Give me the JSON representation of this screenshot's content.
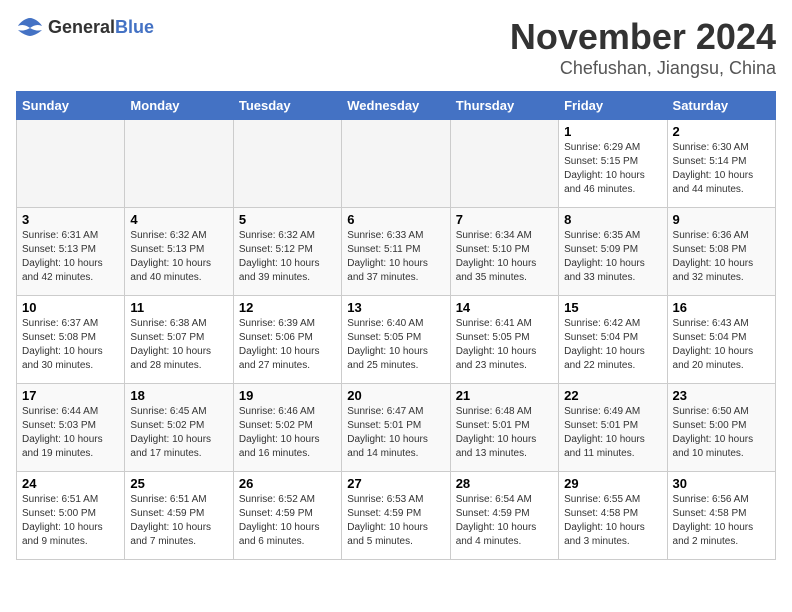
{
  "logo": {
    "general": "General",
    "blue": "Blue"
  },
  "title": "November 2024",
  "location": "Chefushan, Jiangsu, China",
  "days_of_week": [
    "Sunday",
    "Monday",
    "Tuesday",
    "Wednesday",
    "Thursday",
    "Friday",
    "Saturday"
  ],
  "weeks": [
    [
      {
        "day": "",
        "info": ""
      },
      {
        "day": "",
        "info": ""
      },
      {
        "day": "",
        "info": ""
      },
      {
        "day": "",
        "info": ""
      },
      {
        "day": "",
        "info": ""
      },
      {
        "day": "1",
        "info": "Sunrise: 6:29 AM\nSunset: 5:15 PM\nDaylight: 10 hours and 46 minutes."
      },
      {
        "day": "2",
        "info": "Sunrise: 6:30 AM\nSunset: 5:14 PM\nDaylight: 10 hours and 44 minutes."
      }
    ],
    [
      {
        "day": "3",
        "info": "Sunrise: 6:31 AM\nSunset: 5:13 PM\nDaylight: 10 hours and 42 minutes."
      },
      {
        "day": "4",
        "info": "Sunrise: 6:32 AM\nSunset: 5:13 PM\nDaylight: 10 hours and 40 minutes."
      },
      {
        "day": "5",
        "info": "Sunrise: 6:32 AM\nSunset: 5:12 PM\nDaylight: 10 hours and 39 minutes."
      },
      {
        "day": "6",
        "info": "Sunrise: 6:33 AM\nSunset: 5:11 PM\nDaylight: 10 hours and 37 minutes."
      },
      {
        "day": "7",
        "info": "Sunrise: 6:34 AM\nSunset: 5:10 PM\nDaylight: 10 hours and 35 minutes."
      },
      {
        "day": "8",
        "info": "Sunrise: 6:35 AM\nSunset: 5:09 PM\nDaylight: 10 hours and 33 minutes."
      },
      {
        "day": "9",
        "info": "Sunrise: 6:36 AM\nSunset: 5:08 PM\nDaylight: 10 hours and 32 minutes."
      }
    ],
    [
      {
        "day": "10",
        "info": "Sunrise: 6:37 AM\nSunset: 5:08 PM\nDaylight: 10 hours and 30 minutes."
      },
      {
        "day": "11",
        "info": "Sunrise: 6:38 AM\nSunset: 5:07 PM\nDaylight: 10 hours and 28 minutes."
      },
      {
        "day": "12",
        "info": "Sunrise: 6:39 AM\nSunset: 5:06 PM\nDaylight: 10 hours and 27 minutes."
      },
      {
        "day": "13",
        "info": "Sunrise: 6:40 AM\nSunset: 5:05 PM\nDaylight: 10 hours and 25 minutes."
      },
      {
        "day": "14",
        "info": "Sunrise: 6:41 AM\nSunset: 5:05 PM\nDaylight: 10 hours and 23 minutes."
      },
      {
        "day": "15",
        "info": "Sunrise: 6:42 AM\nSunset: 5:04 PM\nDaylight: 10 hours and 22 minutes."
      },
      {
        "day": "16",
        "info": "Sunrise: 6:43 AM\nSunset: 5:04 PM\nDaylight: 10 hours and 20 minutes."
      }
    ],
    [
      {
        "day": "17",
        "info": "Sunrise: 6:44 AM\nSunset: 5:03 PM\nDaylight: 10 hours and 19 minutes."
      },
      {
        "day": "18",
        "info": "Sunrise: 6:45 AM\nSunset: 5:02 PM\nDaylight: 10 hours and 17 minutes."
      },
      {
        "day": "19",
        "info": "Sunrise: 6:46 AM\nSunset: 5:02 PM\nDaylight: 10 hours and 16 minutes."
      },
      {
        "day": "20",
        "info": "Sunrise: 6:47 AM\nSunset: 5:01 PM\nDaylight: 10 hours and 14 minutes."
      },
      {
        "day": "21",
        "info": "Sunrise: 6:48 AM\nSunset: 5:01 PM\nDaylight: 10 hours and 13 minutes."
      },
      {
        "day": "22",
        "info": "Sunrise: 6:49 AM\nSunset: 5:01 PM\nDaylight: 10 hours and 11 minutes."
      },
      {
        "day": "23",
        "info": "Sunrise: 6:50 AM\nSunset: 5:00 PM\nDaylight: 10 hours and 10 minutes."
      }
    ],
    [
      {
        "day": "24",
        "info": "Sunrise: 6:51 AM\nSunset: 5:00 PM\nDaylight: 10 hours and 9 minutes."
      },
      {
        "day": "25",
        "info": "Sunrise: 6:51 AM\nSunset: 4:59 PM\nDaylight: 10 hours and 7 minutes."
      },
      {
        "day": "26",
        "info": "Sunrise: 6:52 AM\nSunset: 4:59 PM\nDaylight: 10 hours and 6 minutes."
      },
      {
        "day": "27",
        "info": "Sunrise: 6:53 AM\nSunset: 4:59 PM\nDaylight: 10 hours and 5 minutes."
      },
      {
        "day": "28",
        "info": "Sunrise: 6:54 AM\nSunset: 4:59 PM\nDaylight: 10 hours and 4 minutes."
      },
      {
        "day": "29",
        "info": "Sunrise: 6:55 AM\nSunset: 4:58 PM\nDaylight: 10 hours and 3 minutes."
      },
      {
        "day": "30",
        "info": "Sunrise: 6:56 AM\nSunset: 4:58 PM\nDaylight: 10 hours and 2 minutes."
      }
    ]
  ]
}
